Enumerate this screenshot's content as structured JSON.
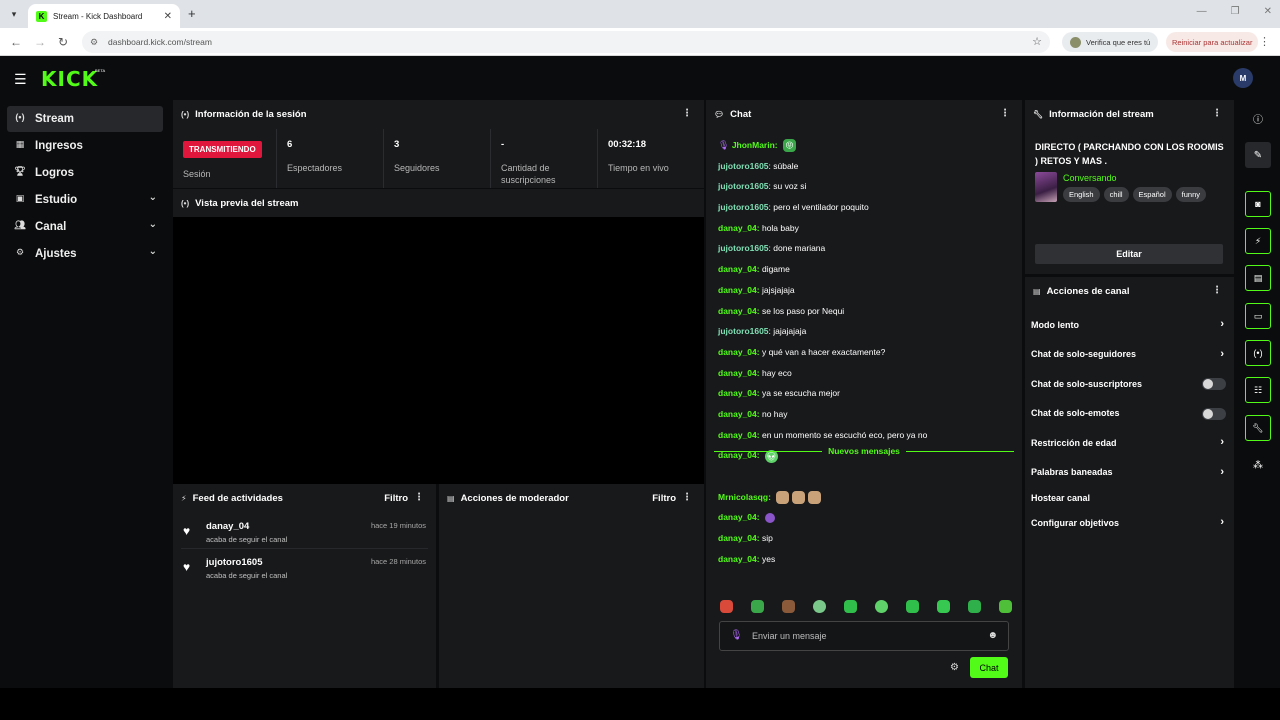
{
  "browser": {
    "tab_title": "Stream - Kick Dashboard",
    "url": "dashboard.kick.com/stream",
    "verify_label": "Verifica que eres tú",
    "update_label": "Reiniciar para actualizar"
  },
  "header": {
    "logo": "KICK",
    "beta": "BETA",
    "avatar_initials": "M"
  },
  "sidebar": {
    "items": [
      {
        "label": "Stream",
        "icon": "broadcast-icon"
      },
      {
        "label": "Ingresos",
        "icon": "chart-icon"
      },
      {
        "label": "Logros",
        "icon": "trophy-icon"
      },
      {
        "label": "Estudio",
        "icon": "studio-icon"
      },
      {
        "label": "Canal",
        "icon": "users-icon"
      },
      {
        "label": "Ajustes",
        "icon": "gear-icon"
      }
    ]
  },
  "session": {
    "title": "Información de la sesión",
    "badge": "TRANSMITIENDO",
    "badge_label": "Sesión",
    "stats": [
      {
        "value": "6",
        "label": "Espectadores"
      },
      {
        "value": "3",
        "label": "Seguidores"
      },
      {
        "value": "-",
        "label": "Cantidad de suscripciones"
      },
      {
        "value": "00:32:18",
        "label": "Tiempo en vivo"
      }
    ]
  },
  "preview": {
    "title": "Vista previa del stream"
  },
  "activity": {
    "title": "Feed de actividades",
    "filter": "Filtro",
    "items": [
      {
        "user": "danay_04",
        "desc": "acaba de seguir el canal",
        "time": "hace 19 minutos"
      },
      {
        "user": "jujotoro1605",
        "desc": "acaba de seguir el canal",
        "time": "hace 28 minutos"
      }
    ]
  },
  "moderator": {
    "title": "Acciones de moderador",
    "filter": "Filtro"
  },
  "chat": {
    "title": "Chat",
    "messages": [
      {
        "user": "JhonMarin",
        "text": "",
        "user_color": "green"
      },
      {
        "user": "jujotoro1605",
        "text": "súbale",
        "user_color": "teal"
      },
      {
        "user": "jujotoro1605",
        "text": "su voz si",
        "user_color": "teal"
      },
      {
        "user": "jujotoro1605",
        "text": "pero el ventilador poquito",
        "user_color": "teal"
      },
      {
        "user": "danay_04",
        "text": "hola baby",
        "user_color": "green"
      },
      {
        "user": "jujotoro1605",
        "text": "done mariana",
        "user_color": "teal"
      },
      {
        "user": "danay_04",
        "text": "digame",
        "user_color": "green"
      },
      {
        "user": "danay_04",
        "text": "jajsjajaja",
        "user_color": "green"
      },
      {
        "user": "danay_04",
        "text": "se los paso por Nequi",
        "user_color": "green"
      },
      {
        "user": "jujotoro1605",
        "text": "jajajajaja",
        "user_color": "teal"
      },
      {
        "user": "danay_04",
        "text": "y qué van a hacer exactamente?",
        "user_color": "green"
      },
      {
        "user": "danay_04",
        "text": "hay eco",
        "user_color": "green"
      },
      {
        "user": "danay_04",
        "text": "ya se escucha mejor",
        "user_color": "green"
      },
      {
        "user": "danay_04",
        "text": "no hay",
        "user_color": "green"
      },
      {
        "user": "danay_04",
        "text": "en un momento se escuchó eco, pero ya no",
        "user_color": "green"
      },
      {
        "user": "danay_04",
        "text": "",
        "user_color": "green"
      }
    ],
    "new_messages_label": "Nuevos mensajes",
    "new_messages": [
      {
        "user": "Mrnicolasqg",
        "text": "",
        "user_color": "green"
      },
      {
        "user": "danay_04",
        "text": "",
        "user_color": "green"
      },
      {
        "user": "danay_04",
        "text": "sip",
        "user_color": "green"
      },
      {
        "user": "danay_04",
        "text": "yes",
        "user_color": "green"
      }
    ],
    "input_placeholder": "Enviar un mensaje",
    "send_label": "Chat"
  },
  "stream_info": {
    "title": "Información del stream",
    "stream_title": "DIRECTO ( PARCHANDO CON LOS ROOMIS ) RETOS Y MAS .",
    "category": "Conversando",
    "tags": [
      "English",
      "chill",
      "Español",
      "funny"
    ],
    "edit_label": "Editar"
  },
  "channel_actions": {
    "title": "Acciones de canal",
    "items": [
      {
        "label": "Modo lento",
        "control": "chevron"
      },
      {
        "label": "Chat de solo-seguidores",
        "control": "chevron"
      },
      {
        "label": "Chat de solo-suscriptores",
        "control": "toggle"
      },
      {
        "label": "Chat de solo-emotes",
        "control": "toggle"
      },
      {
        "label": "Restricción de edad",
        "control": "chevron"
      },
      {
        "label": "Palabras baneadas",
        "control": "chevron"
      },
      {
        "label": "Hostear canal",
        "control": "none"
      },
      {
        "label": "Configurar objetivos",
        "control": "chevron"
      }
    ]
  },
  "colors": {
    "accent": "#53fc18",
    "live": "#e0163c",
    "panel": "#18191b",
    "background": "#0b0c0d"
  }
}
